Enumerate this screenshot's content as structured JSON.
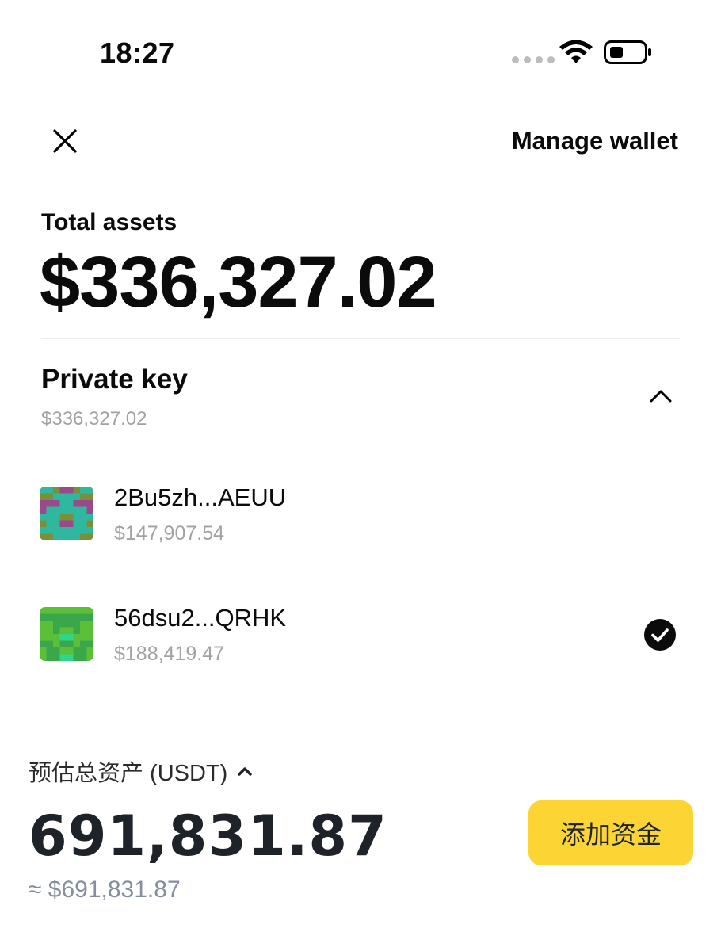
{
  "status_bar": {
    "time": "18:27"
  },
  "header": {
    "manage_label": "Manage wallet"
  },
  "total": {
    "label": "Total assets",
    "value": "$336,327.02"
  },
  "group": {
    "title": "Private key",
    "value": "$336,327.02"
  },
  "wallets": [
    {
      "name": "2Bu5zh...AEUU",
      "balance": "$147,907.54",
      "selected": false
    },
    {
      "name": "56dsu2...QRHK",
      "balance": "$188,419.47",
      "selected": true
    }
  ],
  "estimate": {
    "label": "预估总资产 (USDT)",
    "value": "691,831.87",
    "usd": "≈ $691,831.87",
    "add_funds_label": "添加资金"
  },
  "colors": {
    "accent_yellow": "#fcd535",
    "muted_text": "#a2a2a2",
    "avatar1": [
      "#2fb8a0",
      "#7a8f3a",
      "#9a4a8a"
    ],
    "avatar2": [
      "#5cbf3a",
      "#3aa84a",
      "#2fd68a"
    ]
  },
  "icons": {
    "close": "close-icon",
    "collapse": "chevron-up-icon",
    "selected": "check-circle-icon",
    "estimate_toggle": "caret-up-icon"
  }
}
